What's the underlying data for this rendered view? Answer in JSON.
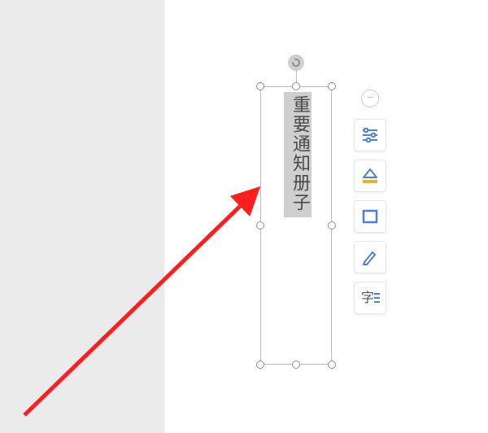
{
  "text_box": {
    "content": "重要通知册子"
  },
  "toolbar": {
    "collapse_label": "−",
    "buttons": [
      {
        "name": "format-options",
        "icon": "format-options-icon"
      },
      {
        "name": "fill-color",
        "icon": "fill-color-icon"
      },
      {
        "name": "outline",
        "icon": "outline-icon"
      },
      {
        "name": "edit-text",
        "icon": "pencil-icon"
      },
      {
        "name": "text-style",
        "icon": "text-style-icon"
      }
    ]
  },
  "colors": {
    "accent_blue": "#4A7FE0",
    "accent_yellow": "#F2B11A",
    "annotation_red": "#FF1E1E"
  }
}
